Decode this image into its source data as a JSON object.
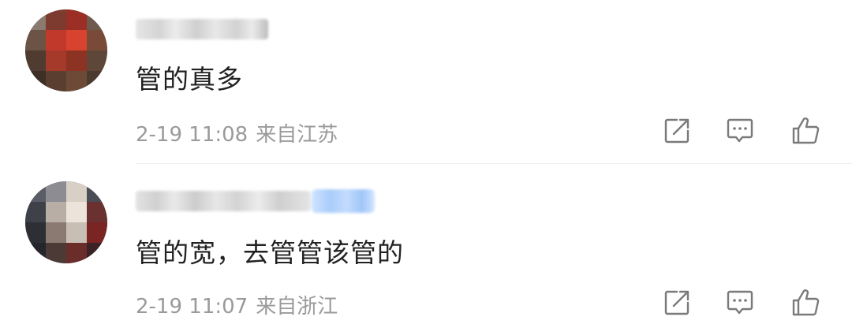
{
  "comments": [
    {
      "text": "管的真多",
      "date": "2-19 11:08",
      "location": "来自江苏"
    },
    {
      "text": "管的宽，去管管该管的",
      "date": "2-19 11:07",
      "location": "来自浙江"
    }
  ],
  "icons": {
    "share": "share-icon",
    "reply": "comment-icon",
    "like": "thumbs-up-icon"
  },
  "colors": {
    "text": "#222222",
    "meta": "#9a9a9a",
    "icon": "#7a7a7a",
    "badge": "#a9cdfa"
  }
}
